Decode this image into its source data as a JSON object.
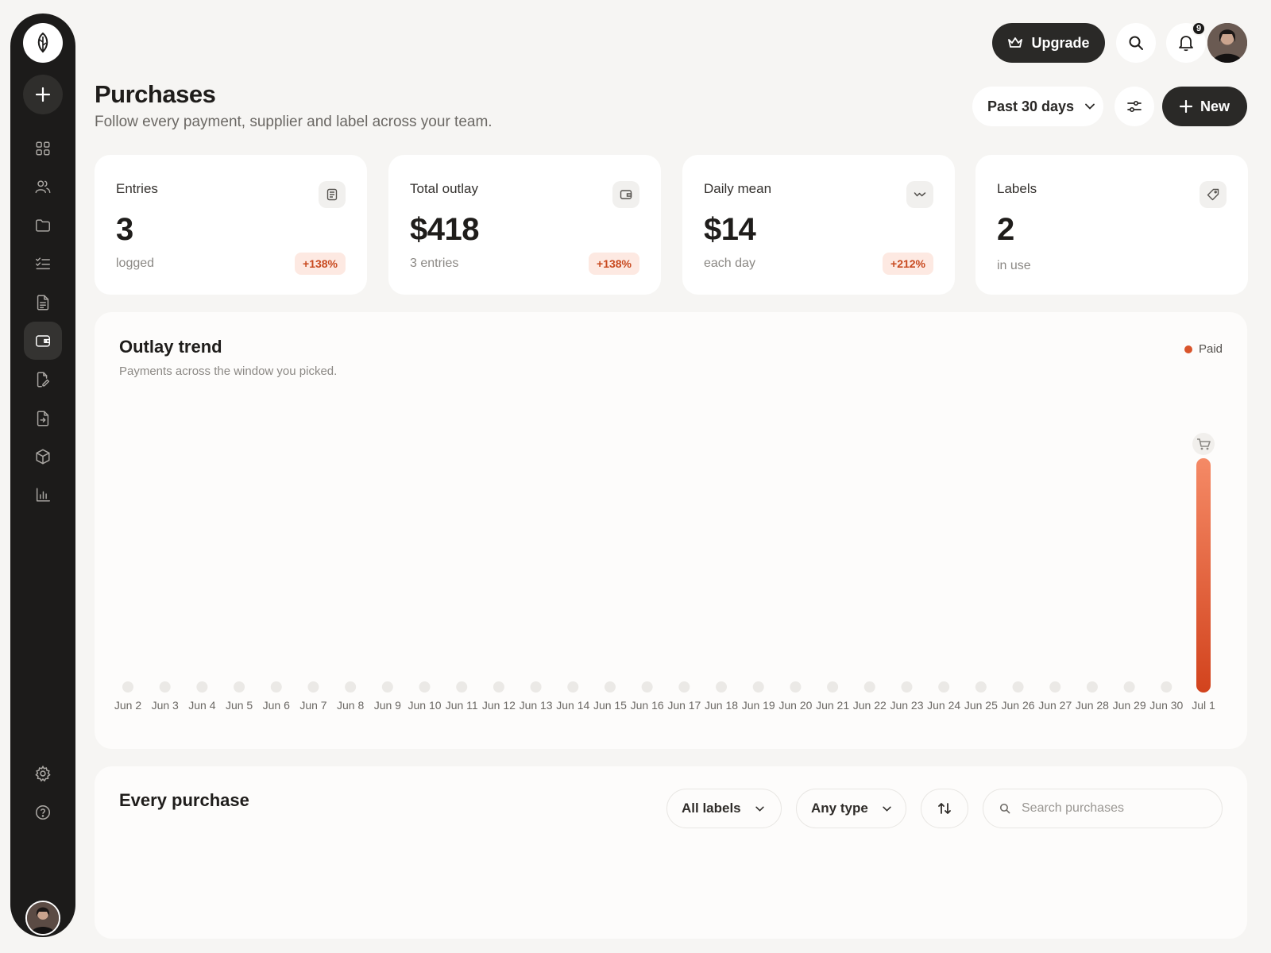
{
  "sidebar": {
    "logo_icon": "leaf-logo-icon",
    "add_icon": "plus-icon",
    "items": [
      {
        "icon": "grid-icon",
        "label": "Dashboard",
        "active": false
      },
      {
        "icon": "users-icon",
        "label": "Team",
        "active": false
      },
      {
        "icon": "folder-icon",
        "label": "Files",
        "active": false
      },
      {
        "icon": "checklist-icon",
        "label": "Tasks",
        "active": false
      },
      {
        "icon": "document-icon",
        "label": "Documents",
        "active": false
      },
      {
        "icon": "wallet-icon",
        "label": "Purchases",
        "active": true
      },
      {
        "icon": "edit-file-icon",
        "label": "Drafts",
        "active": false
      },
      {
        "icon": "file-export-icon",
        "label": "Exports",
        "active": false
      },
      {
        "icon": "box-icon",
        "label": "Products",
        "active": false
      },
      {
        "icon": "bar-chart-icon",
        "label": "Reports",
        "active": false
      }
    ],
    "settings_icon": "gear-icon",
    "help_icon": "help-icon"
  },
  "topbar": {
    "upgrade_label": "Upgrade",
    "notification_count": "9"
  },
  "header": {
    "title": "Purchases",
    "subtitle": "Follow every payment, supplier and label across your team.",
    "range": "Past 30 days",
    "new_label": "New"
  },
  "stats": [
    {
      "label": "Entries",
      "value": "3",
      "sub": "logged",
      "change": "+138%",
      "icon": "receipt-icon"
    },
    {
      "label": "Total outlay",
      "value": "$418",
      "sub": "3 entries",
      "change": "+138%",
      "icon": "wallet-icon"
    },
    {
      "label": "Daily mean",
      "value": "$14",
      "sub": "each day",
      "change": "+212%",
      "icon": "trend-icon"
    },
    {
      "label": "Labels",
      "value": "2",
      "sub": "in use",
      "change": "",
      "icon": "tag-icon"
    }
  ],
  "chart": {
    "title": "Outlay trend",
    "subtitle": "Payments across the window you picked.",
    "legend": "Paid",
    "colors": {
      "bar_top": "#f58a66",
      "bar_bottom": "#d2431d",
      "empty_dot": "#ebe9e6"
    }
  },
  "chart_data": {
    "type": "bar",
    "categories": [
      "Jun 2",
      "Jun 3",
      "Jun 4",
      "Jun 5",
      "Jun 6",
      "Jun 7",
      "Jun 8",
      "Jun 9",
      "Jun 10",
      "Jun 11",
      "Jun 12",
      "Jun 13",
      "Jun 14",
      "Jun 15",
      "Jun 16",
      "Jun 17",
      "Jun 18",
      "Jun 19",
      "Jun 20",
      "Jun 21",
      "Jun 22",
      "Jun 23",
      "Jun 24",
      "Jun 25",
      "Jun 26",
      "Jun 27",
      "Jun 28",
      "Jun 29",
      "Jun 30",
      "Jul 1"
    ],
    "series": [
      {
        "name": "Paid",
        "values": [
          0,
          0,
          0,
          0,
          0,
          0,
          0,
          0,
          0,
          0,
          0,
          0,
          0,
          0,
          0,
          0,
          0,
          0,
          0,
          0,
          0,
          0,
          0,
          0,
          0,
          0,
          0,
          0,
          0,
          418
        ]
      }
    ],
    "peak_marker_icon": "shopping-cart-icon",
    "grid": false,
    "legend_position": "top-right"
  },
  "table": {
    "title": "Every purchase",
    "label_filter": "All labels",
    "type_filter": "Any type",
    "search_placeholder": "Search purchases"
  }
}
